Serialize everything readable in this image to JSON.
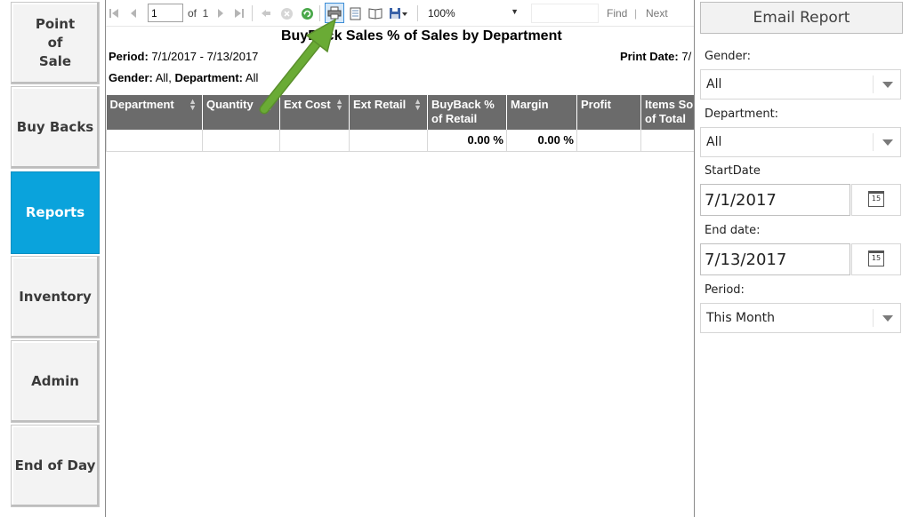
{
  "nav": {
    "items": [
      {
        "label": "Point\nof\nSale",
        "active": false
      },
      {
        "label": "Buy Backs",
        "active": false
      },
      {
        "label": "Reports",
        "active": true
      },
      {
        "label": "Inventory",
        "active": false
      },
      {
        "label": "Admin",
        "active": false
      },
      {
        "label": "End of Day",
        "active": false
      }
    ]
  },
  "toolbar": {
    "page_value": "1",
    "of_label": "of",
    "total_pages": "1",
    "zoom": "100%",
    "find_label": "Find",
    "next_label": "Next",
    "divider": "|"
  },
  "report": {
    "title": "BuyBack Sales % of Sales by Department",
    "period_label": "Period:",
    "period_value": "7/1/2017 - 7/13/2017",
    "print_label": "Print Date:",
    "print_value": "7/",
    "gender_label": "Gender:",
    "gender_value": "All,",
    "department_label": "Department:",
    "department_value": "All",
    "columns": [
      "Department",
      "Quantity",
      "Ext Cost",
      "Ext Retail",
      "BuyBack % of Retail",
      "Margin",
      "Profit",
      "Items Sold of Total"
    ],
    "rows": [
      [
        "",
        "",
        "",
        "",
        "0.00 %",
        "0.00 %",
        "",
        ""
      ]
    ]
  },
  "panel": {
    "email_button": "Email Report",
    "gender_label": "Gender:",
    "gender_value": "All",
    "department_label": "Department:",
    "department_value": "All",
    "start_label": "StartDate",
    "start_value": "7/1/2017",
    "end_label": "End date:",
    "end_value": "7/13/2017",
    "period_label": "Period:",
    "period_value": "This Month",
    "calendar_day": "15"
  },
  "colors": {
    "active_nav": "#0aa3dc",
    "header_bg": "#6b6b6b",
    "arrow": "#6aab35"
  }
}
